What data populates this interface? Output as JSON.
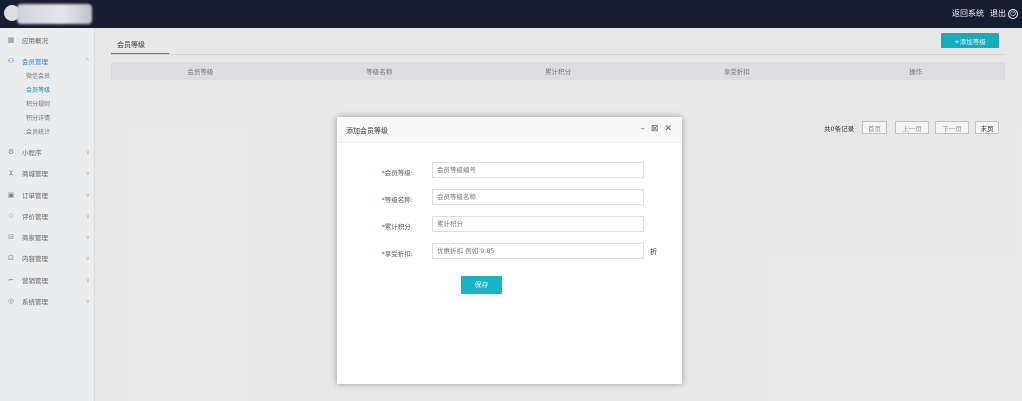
{
  "topbar": {
    "return_label": "返回系统",
    "exit_label": "退出"
  },
  "sidebar": {
    "items": [
      {
        "icon": "grid-icon",
        "label": "应用概况"
      },
      {
        "icon": "members-icon",
        "label": "会员管理"
      },
      {
        "icon": "mini-program-icon",
        "label": "小程序"
      },
      {
        "icon": "cart-icon",
        "label": "商城管理"
      },
      {
        "icon": "order-icon",
        "label": "订单管理"
      },
      {
        "icon": "star-icon",
        "label": "评价管理"
      },
      {
        "icon": "store-icon",
        "label": "商家管理"
      },
      {
        "icon": "content-icon",
        "label": "内容管理"
      },
      {
        "icon": "marketing-icon",
        "label": "营销管理"
      },
      {
        "icon": "settings-icon",
        "label": "系统管理"
      }
    ],
    "subitems": [
      "微信会员",
      "会员等级",
      "积分规则",
      "积分详情",
      "会员统计"
    ]
  },
  "main": {
    "tab": "会员等级",
    "add_button": "+添加等级",
    "columns": [
      "会员等级",
      "等级名称",
      "累计积分",
      "享受折扣",
      "操作"
    ],
    "pager": {
      "total": "共0条记录",
      "first": "首页",
      "prev": "上一页",
      "next": "下一页",
      "last": "末页"
    }
  },
  "modal": {
    "title": "添加会员等级",
    "fields": [
      {
        "label": "会员等级:",
        "placeholder": "会员等级编号"
      },
      {
        "label": "等级名称:",
        "placeholder": "会员等级名称"
      },
      {
        "label": "累计积分:",
        "placeholder": "累计积分"
      },
      {
        "label": "享受折扣:",
        "placeholder": "优惠折扣 例如 9.85"
      }
    ],
    "unit": "折",
    "save": "保存"
  }
}
